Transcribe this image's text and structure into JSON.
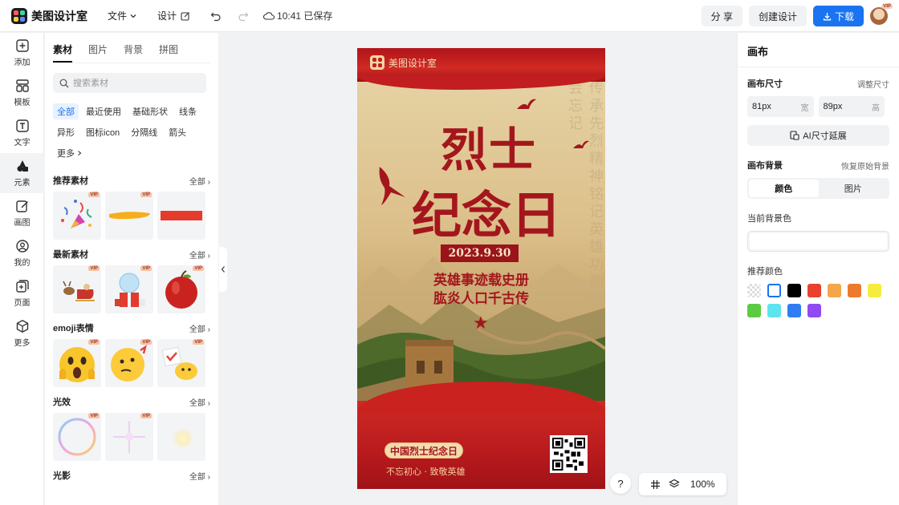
{
  "topbar": {
    "app_name": "美图设计室",
    "menu": {
      "file": "文件",
      "design": "设计"
    },
    "save_status": "10:41 已保存",
    "share": "分 享",
    "create_design": "创建设计",
    "download": "下载",
    "avatar_badge": "VIP"
  },
  "rail": [
    {
      "label": "添加",
      "icon": "plus-square-icon"
    },
    {
      "label": "模板",
      "icon": "template-grid-icon"
    },
    {
      "label": "文字",
      "icon": "text-icon"
    },
    {
      "label": "元素",
      "icon": "shapes-icon"
    },
    {
      "label": "画图",
      "icon": "pencil-icon"
    },
    {
      "label": "我的",
      "icon": "user-icon"
    },
    {
      "label": "页面",
      "icon": "page-add-icon"
    },
    {
      "label": "更多",
      "icon": "cube-icon"
    }
  ],
  "panel": {
    "tabs": [
      "素材",
      "图片",
      "背景",
      "拼图"
    ],
    "search_placeholder": "搜索素材",
    "filters": [
      "全部",
      "最近使用",
      "基础形状",
      "线条",
      "异形",
      "图标icon",
      "分隔线",
      "箭头",
      "更多"
    ],
    "all_label": "全部",
    "vip_label": "VIP",
    "sections": [
      {
        "title": "推荐素材"
      },
      {
        "title": "最新素材"
      },
      {
        "title": "emoji表情"
      },
      {
        "title": "光效"
      },
      {
        "title": "光影"
      }
    ]
  },
  "poster": {
    "brand": "美图设计室",
    "title_line1": "烈士",
    "title_line2": "纪念日",
    "date": "2023.9.30",
    "line1": "英雄事迹载史册",
    "line2": "肱炎人口千古传",
    "badge": "中国烈士纪念日",
    "slogan": "不忘初心 · 致敬英雄",
    "bg_text": "传承先烈精神铭记英雄功勋我们不会忘记"
  },
  "bottom": {
    "help": "?",
    "zoom": "100%"
  },
  "right": {
    "title": "画布",
    "canvas_size_label": "画布尺寸",
    "adjust_size": "调整尺寸",
    "width_value": "81px",
    "width_unit": "宽",
    "height_value": "89px",
    "height_unit": "高",
    "ai_button": "AI尺寸延展",
    "bg_label": "画布背景",
    "restore_bg": "恢复原始背景",
    "seg_color": "颜色",
    "seg_image": "图片",
    "current_bg_label": "当前背景色",
    "recommend_label": "推荐颜色",
    "colors": [
      "transparent",
      "#ffffff",
      "#000000",
      "#e8412e",
      "#f3a64a",
      "#ee7a2e",
      "#f6ec3e",
      "#5ccb43",
      "#5ee4ef",
      "#2f7df1",
      "#8f4af1"
    ]
  }
}
